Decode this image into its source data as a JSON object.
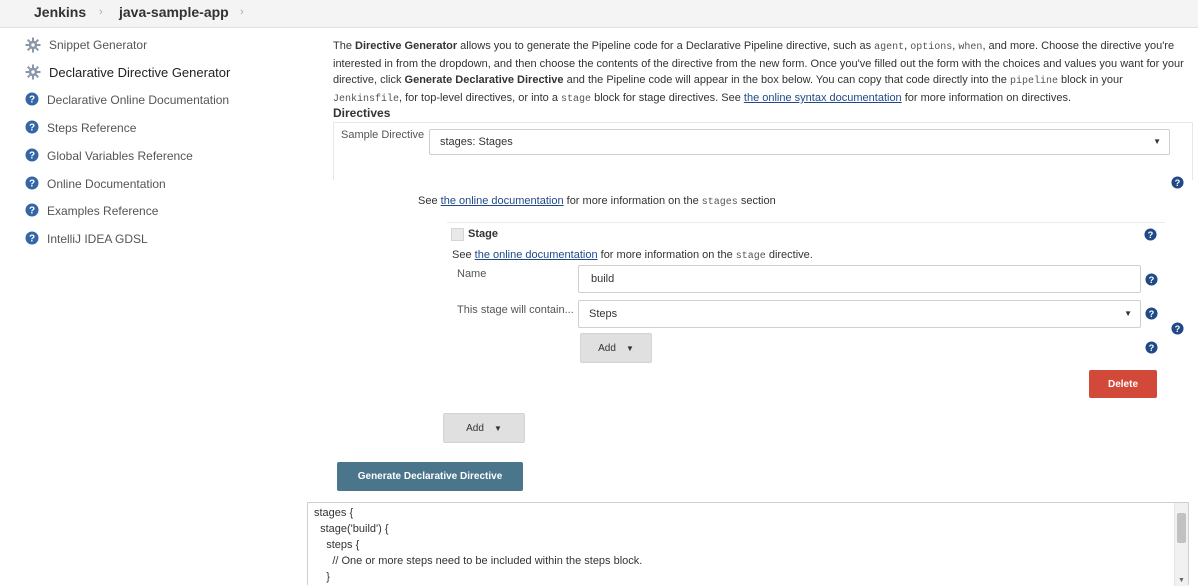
{
  "breadcrumb": {
    "items": [
      "Jenkins",
      "java-sample-app"
    ],
    "separator": "›"
  },
  "sidebar": {
    "items": [
      {
        "label": "Snippet Generator",
        "icon": "gear-icon"
      },
      {
        "label": "Declarative Directive Generator",
        "icon": "gear-icon"
      },
      {
        "label": "Declarative Online Documentation",
        "icon": "help-icon"
      },
      {
        "label": "Steps Reference",
        "icon": "help-icon"
      },
      {
        "label": "Global Variables Reference",
        "icon": "help-icon"
      },
      {
        "label": "Online Documentation",
        "icon": "help-icon"
      },
      {
        "label": "Examples Reference",
        "icon": "help-icon"
      },
      {
        "label": "IntelliJ IDEA GDSL",
        "icon": "help-icon"
      }
    ]
  },
  "intro": {
    "t1": "The ",
    "b1": "Directive Generator",
    "t2": " allows you to generate the Pipeline code for a Declarative Pipeline directive, such as ",
    "c1": "agent",
    "t3": ", ",
    "c2": "options",
    "t4": ", ",
    "c3": "when",
    "t5": ", and more. Choose the directive you're interested in from the dropdown, and then choose the contents of the directive from the new form. Once you've filled out the form with the choices and values you want for your directive, click ",
    "b2": "Generate Declarative Directive",
    "t6": " and the Pipeline code will appear in the box below. You can copy that code directly into the ",
    "c4": "pipeline",
    "t7": " block in your ",
    "c5": "Jenkinsfile",
    "t8": ", for top-level directives, or into a ",
    "c6": "stage",
    "t9": " block for stage directives. See ",
    "link": "the online syntax documentation",
    "t10": " for more information on directives."
  },
  "directives": {
    "section_title": "Directives",
    "sample_label": "Sample Directive",
    "sample_value": "stages: Stages",
    "stages_note": {
      "pre": "See ",
      "link": "the online documentation",
      "mid": " for more information on the ",
      "code": "stages",
      "post": " section"
    },
    "stage": {
      "title": "Stage",
      "note_pre": "See ",
      "note_link": "the online documentation",
      "note_mid": " for more information on the ",
      "note_code": "stage",
      "note_post": " directive.",
      "name_label": "Name",
      "name_value": "build",
      "contains_label": "This stage will contain...",
      "contains_value": "Steps",
      "add_label": "Add",
      "delete_label": "Delete"
    },
    "outer_add_label": "Add"
  },
  "generate_button": "Generate Declarative Directive",
  "output_code": [
    "stages {",
    "  stage('build') {",
    "    steps {",
    "      // One or more steps need to be included within the steps block.",
    "    }"
  ],
  "colors": {
    "delete": "#d24939",
    "generate": "#4b758b",
    "help": "#204a87"
  }
}
